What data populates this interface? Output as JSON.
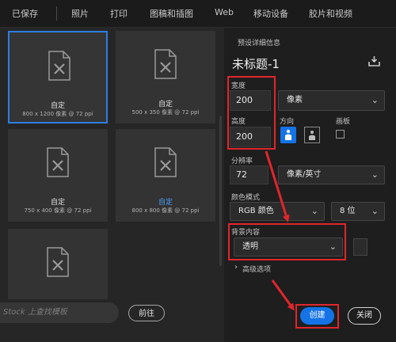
{
  "topbar": {
    "tabs": [
      "已保存",
      "照片",
      "打印",
      "图稿和插图",
      "Web",
      "移动设备",
      "胶片和视频"
    ]
  },
  "presets": [
    {
      "title": "自定",
      "sub": "800 x 1200 像素 @ 72 ppi"
    },
    {
      "title": "自定",
      "sub": "500 x 350 像素 @ 72 ppi"
    },
    {
      "title": "自定",
      "sub": "750 x 400 像素 @ 72 ppi"
    },
    {
      "title": "自定",
      "sub": "800 x 800 像素 @ 72 ppi"
    },
    {
      "title": "",
      "sub": ""
    }
  ],
  "stock": {
    "placeholder": "Stock 上查找模板",
    "go_label": "前往"
  },
  "details": {
    "section_label": "预设详细信息",
    "doc_name": "未标题-1",
    "width_label": "宽度",
    "width_value": "200",
    "width_unit": "像素",
    "height_label": "高度",
    "height_value": "200",
    "orientation_label": "方向",
    "artboard_label": "画板",
    "resolution_label": "分辨率",
    "resolution_value": "72",
    "resolution_unit": "像素/英寸",
    "color_mode_label": "颜色模式",
    "color_mode_value": "RGB 颜色",
    "bit_depth_value": "8 位",
    "background_label": "背景内容",
    "background_value": "透明",
    "advanced_label": "高级选项"
  },
  "buttons": {
    "create": "创建",
    "close": "关闭"
  },
  "colors": {
    "accent": "#1473e6",
    "annotation": "#e0262d",
    "selected_border": "#2d7ee0"
  }
}
